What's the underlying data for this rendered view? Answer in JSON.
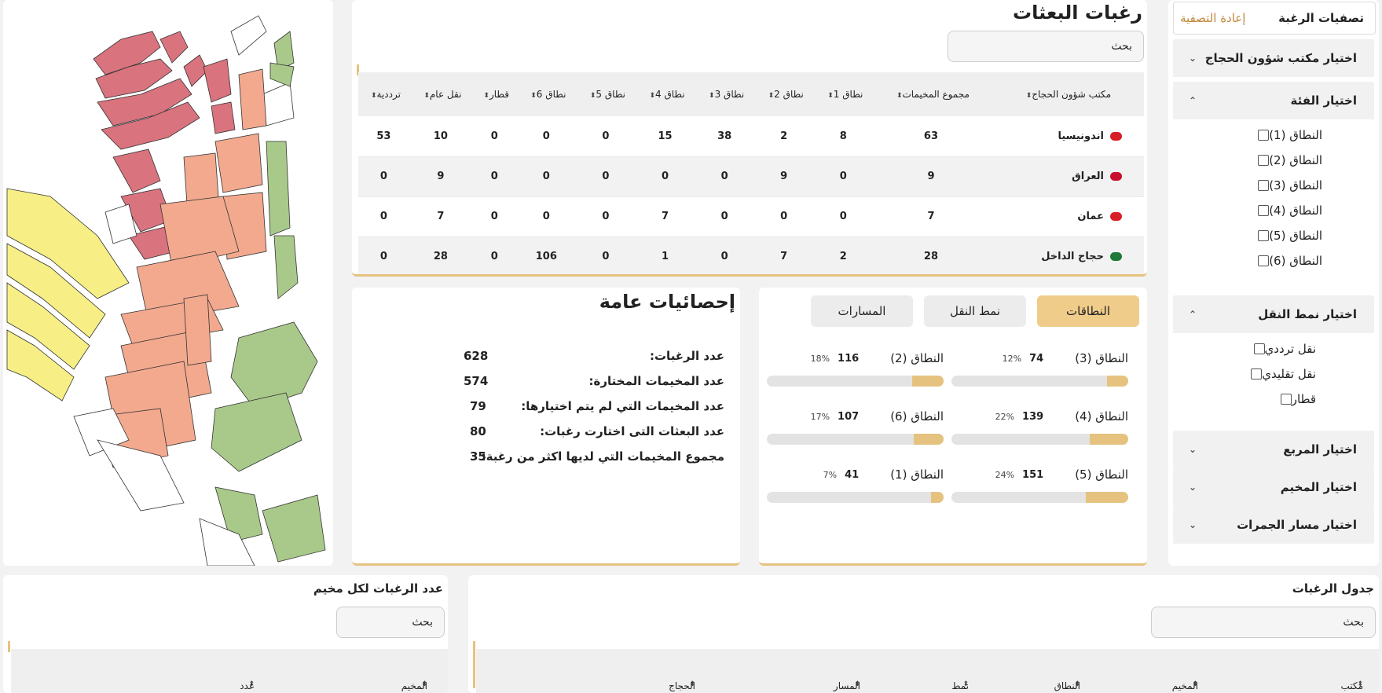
{
  "filters": {
    "title": "تصفيات الرغبة",
    "reset": "إعادة التصفية",
    "office_section": "اختيار مكتب شؤون الحجاج",
    "category_section": "اختيار الفئة",
    "categories": [
      "النطاق (1)",
      "النطاق (2)",
      "النطاق (3)",
      "النطاق (4)",
      "النطاق (5)",
      "النطاق (6)"
    ],
    "transport_section": "اختيار نمط النقل",
    "transport_options": [
      "نقل ترددي",
      "نقل تقليدي",
      "قطار"
    ],
    "square_section": "اختيار المربع",
    "camp_section": "اختيار المخيم",
    "jamarat_section": "اختيار مسار الجمرات"
  },
  "missions": {
    "title": "رغبات البعثات",
    "search_placeholder": "بحث",
    "headers": [
      "مكتب شؤون الحجاج",
      "مجموع المخيمات",
      "نطاق 1",
      "نطاق 2",
      "نطاق 3",
      "نطاق 4",
      "نطاق 5",
      "نطاق 6",
      "قطار",
      "نقل عام",
      "ترددية"
    ],
    "rows": [
      {
        "country": "اندونيسيا",
        "flag": "#d71f26",
        "values": [
          "63",
          "8",
          "2",
          "38",
          "15",
          "0",
          "0",
          "0",
          "10",
          "53"
        ]
      },
      {
        "country": "العراق",
        "flag": "#c8102e",
        "values": [
          "9",
          "0",
          "9",
          "0",
          "0",
          "0",
          "0",
          "0",
          "9",
          "0"
        ]
      },
      {
        "country": "عمان",
        "flag": "#d81f26",
        "values": [
          "7",
          "0",
          "0",
          "0",
          "7",
          "0",
          "0",
          "0",
          "7",
          "0"
        ]
      },
      {
        "country": "حجاج الداخل",
        "flag": "#1f7a3a",
        "values": [
          "28",
          "2",
          "7",
          "0",
          "1",
          "0",
          "106",
          "0",
          "28",
          "0"
        ]
      }
    ]
  },
  "tabs": {
    "items": [
      "النطاقات",
      "نمط النقل",
      "المسارات"
    ],
    "active": 0
  },
  "zones": [
    {
      "name": "النطاق (3)",
      "count": "74",
      "pct": "12%",
      "fill": 0.12
    },
    {
      "name": "النطاق (2)",
      "count": "116",
      "pct": "18%",
      "fill": 0.18
    },
    {
      "name": "النطاق (4)",
      "count": "139",
      "pct": "22%",
      "fill": 0.22
    },
    {
      "name": "النطاق (6)",
      "count": "107",
      "pct": "17%",
      "fill": 0.17
    },
    {
      "name": "النطاق (5)",
      "count": "151",
      "pct": "24%",
      "fill": 0.24
    },
    {
      "name": "النطاق (1)",
      "count": "41",
      "pct": "7%",
      "fill": 0.07
    }
  ],
  "stats": {
    "title": "إحصائيات عامة",
    "rows": [
      {
        "label": "عدد الرغبات:",
        "value": "628"
      },
      {
        "label": "عدد المخيمات المختارة:",
        "value": "574"
      },
      {
        "label": "عدد المخيمات التي لم يتم اختيارها:",
        "value": "79"
      },
      {
        "label": "عدد البعثات التى اختارت رغبات:",
        "value": "80"
      },
      {
        "label": "مجموع المخيمات التي لديها اكثر من رغبة:",
        "value": "35"
      }
    ]
  },
  "camp_table": {
    "title": "عدد الرغبات لكل مخيم",
    "search_placeholder": "بحث",
    "headers": [
      "المخيم",
      "عدد الرغبات"
    ]
  },
  "wish_table": {
    "title": "جدول الرغبات",
    "search_placeholder": "بحث",
    "headers": [
      "مكتب شؤون الحجاج",
      "المخيم",
      "النطاق",
      "نمط النقل",
      "المسار",
      "الحجاج"
    ]
  },
  "colors": {
    "accent": "#e6c27f",
    "zone_pink": "#d9737e",
    "zone_salmon": "#f2a98e",
    "zone_yellow": "#f7ef86",
    "zone_green": "#a9c98a"
  }
}
